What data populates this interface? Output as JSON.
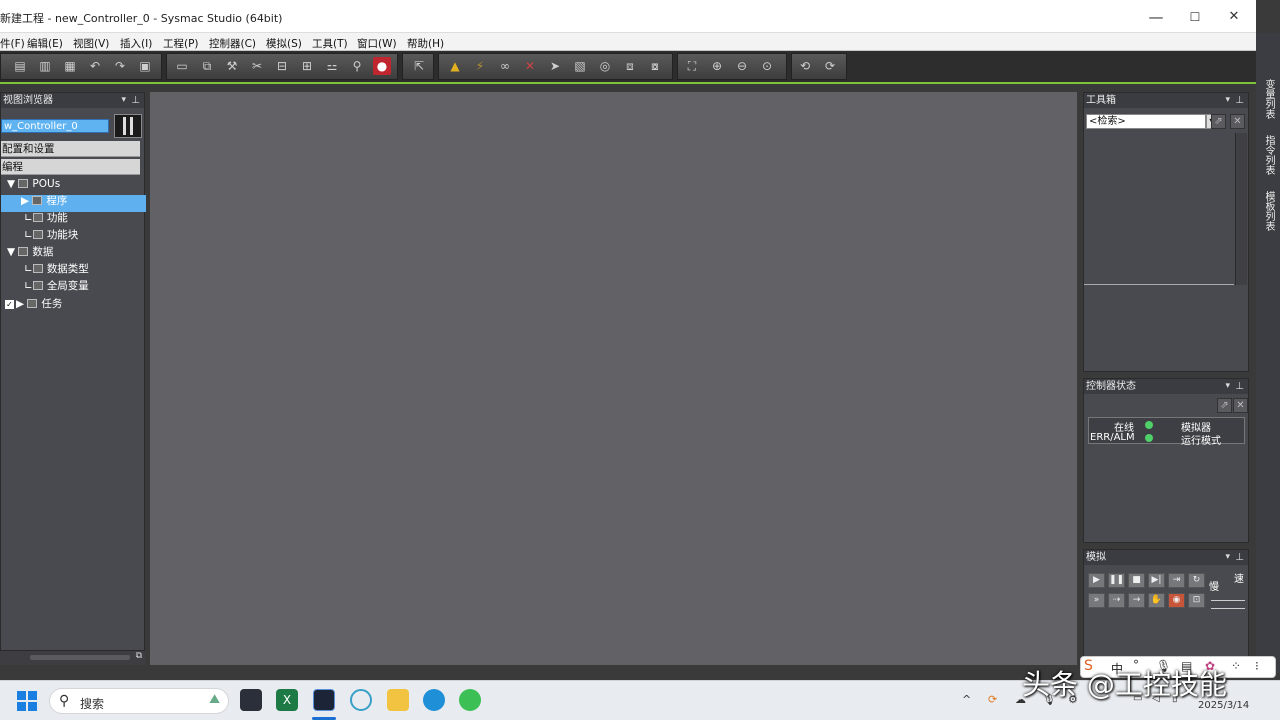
{
  "window": {
    "title": "新建工程 - new_Controller_0 - Sysmac Studio (64bit)",
    "minimize": "—",
    "maximize": "☐",
    "close": "✕"
  },
  "menu": [
    "件(F)",
    "编辑(E)",
    "视图(V)",
    "插入(I)",
    "工程(P)",
    "控制器(C)",
    "模拟(S)",
    "工具(T)",
    "窗口(W)",
    "帮助(H)"
  ],
  "left_panel": {
    "title": "视图浏览器",
    "controller": "w_Controller_0",
    "sections": [
      "配置和设置",
      "编程"
    ],
    "tree": [
      {
        "label": "POUs"
      },
      {
        "label": "程序"
      },
      {
        "label": "功能"
      },
      {
        "label": "功能块"
      },
      {
        "label": "数据"
      },
      {
        "label": "数据类型"
      },
      {
        "label": "全局变量"
      },
      {
        "label": "任务"
      }
    ]
  },
  "toolbox": {
    "title": "工具箱",
    "search_value": "<检索>"
  },
  "controller_status": {
    "title": "控制器状态",
    "online": "在线",
    "err": "ERR/ALM",
    "sim": "模拟器",
    "mode": "运行模式",
    "status_color": "#4fd069"
  },
  "simulation": {
    "title": "模拟",
    "slow": "慢",
    "fast": "速"
  },
  "side_tabs": [
    "变量列表",
    "指令列表",
    "模板列表"
  ],
  "taskbar": {
    "search_label": "搜索",
    "date": "2025/3/14",
    "ime": "中"
  },
  "watermark": "头条 @工控技能"
}
